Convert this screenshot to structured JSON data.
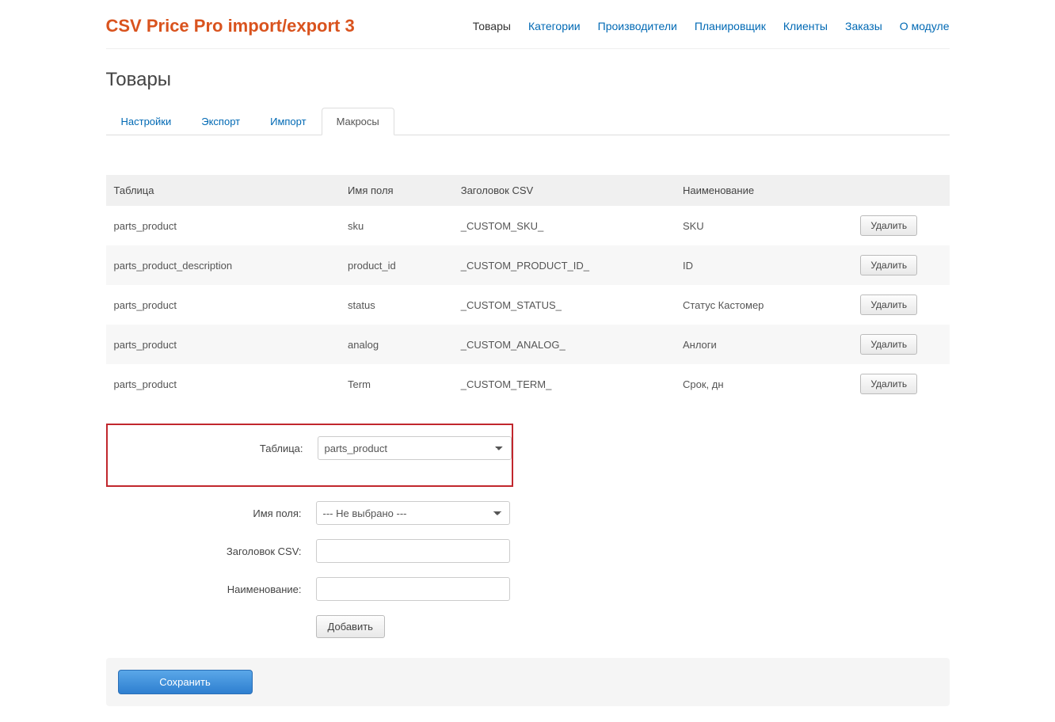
{
  "header": {
    "title": "CSV Price Pro import/export 3",
    "nav": [
      "Товары",
      "Категории",
      "Производители",
      "Планировщик",
      "Клиенты",
      "Заказы",
      "О модуле"
    ],
    "active_nav": 0
  },
  "page_title": "Товары",
  "tabs": [
    "Настройки",
    "Экспорт",
    "Импорт",
    "Макросы"
  ],
  "active_tab": 3,
  "table": {
    "headers": [
      "Таблица",
      "Имя поля",
      "Заголовок CSV",
      "Наименование",
      ""
    ],
    "rows": [
      {
        "table": "parts_product",
        "field": "sku",
        "csv": "_CUSTOM_SKU_",
        "name": "SKU"
      },
      {
        "table": "parts_product_description",
        "field": "product_id",
        "csv": "_CUSTOM_PRODUCT_ID_",
        "name": "ID"
      },
      {
        "table": "parts_product",
        "field": "status",
        "csv": "_CUSTOM_STATUS_",
        "name": "Статус Кастомер"
      },
      {
        "table": "parts_product",
        "field": "analog",
        "csv": "_CUSTOM_ANALOG_",
        "name": "Анлоги"
      },
      {
        "table": "parts_product",
        "field": "Term",
        "csv": "_CUSTOM_TERM_",
        "name": "Срок, дн"
      }
    ],
    "delete_label": "Удалить"
  },
  "form": {
    "labels": {
      "table": "Таблица:",
      "field": "Имя поля:",
      "csv": "Заголовок CSV:",
      "name": "Наименование:"
    },
    "table_value": "parts_product",
    "field_value": "--- Не выбрано ---",
    "csv_value": "",
    "name_value": "",
    "add_label": "Добавить"
  },
  "save_label": "Сохранить"
}
